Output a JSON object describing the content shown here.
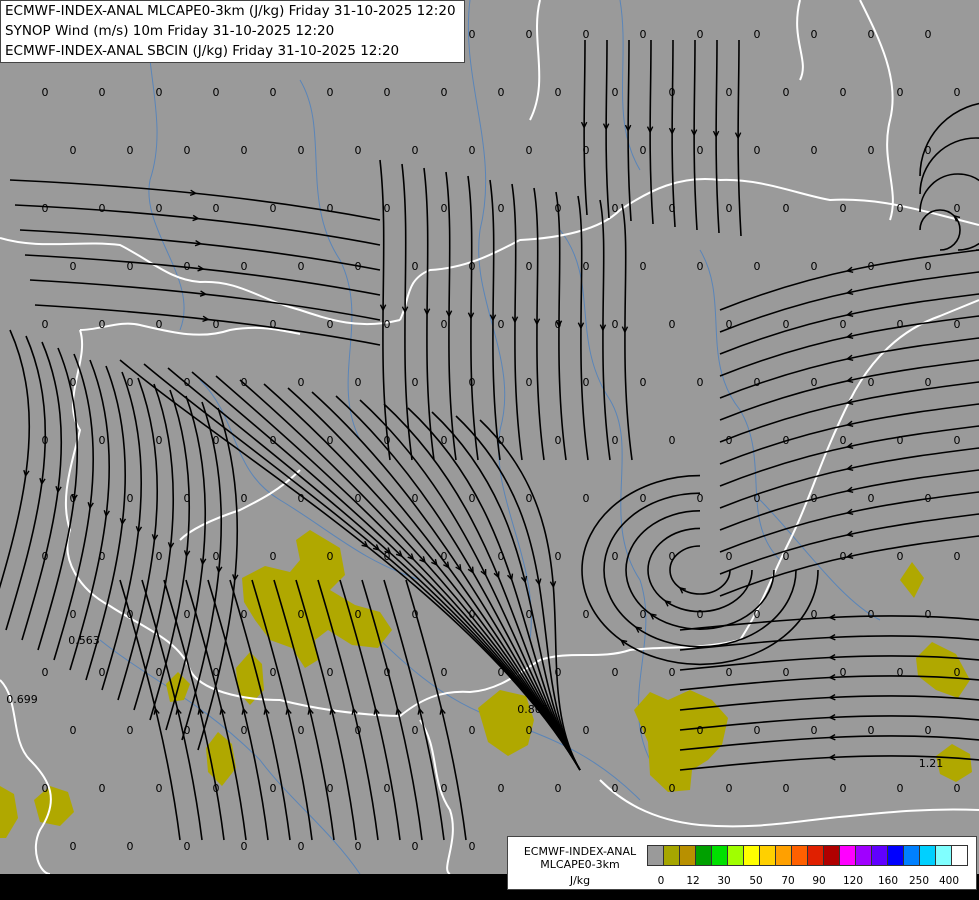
{
  "header": {
    "lines": [
      "ECMWF-INDEX-ANAL MLCAPE0-3km (J/kg) Friday 31-10-2025 12:20",
      "SYNOP Wind (m/s) 10m Friday 31-10-2025 12:20",
      "ECMWF-INDEX-ANAL SBCIN (J/kg) Friday 31-10-2025 12:20"
    ]
  },
  "legend": {
    "title_line1": "ECMWF-INDEX-ANAL",
    "title_line2": "MLCAPE0-3km",
    "unit": "J/kg",
    "colors": [
      "#9a9a9a",
      "#a6a600",
      "#b89000",
      "#00a000",
      "#00e000",
      "#a0ff00",
      "#ffff00",
      "#ffd000",
      "#ffa000",
      "#ff6000",
      "#e02000",
      "#b00000",
      "#ff00ff",
      "#a000ff",
      "#6000ff",
      "#0000ff",
      "#0080ff",
      "#00d0ff",
      "#80ffff",
      "#ffffff"
    ],
    "ticks": [
      "0",
      "12",
      "30",
      "50",
      "70",
      "90",
      "120",
      "160",
      "250",
      "400"
    ]
  },
  "map_labels": {
    "zero": "0",
    "specials": [
      "0.563",
      "0.699",
      "0.805",
      "1.21"
    ]
  },
  "colors": {
    "background": "#9a9a9a",
    "cape_fill": "#b0a800",
    "border": "#ffffff",
    "river": "#4a7fc0",
    "streamline": "#000000"
  }
}
